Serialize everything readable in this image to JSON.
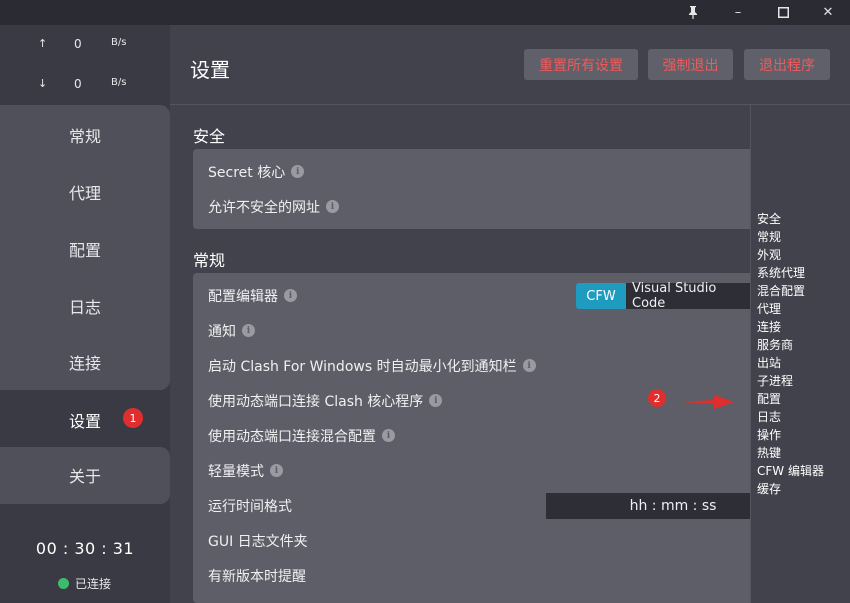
{
  "window": {
    "pin_icon": "pin-icon",
    "minimize": "–",
    "maximize": "☐",
    "close": "✕"
  },
  "traffic": {
    "up": {
      "arrow": "↑",
      "value": "0",
      "unit": "B/s"
    },
    "down": {
      "arrow": "↓",
      "value": "0",
      "unit": "B/s"
    }
  },
  "sidebar": {
    "items": [
      {
        "label": "常规"
      },
      {
        "label": "代理"
      },
      {
        "label": "配置"
      },
      {
        "label": "日志"
      },
      {
        "label": "连接"
      },
      {
        "label": "设置",
        "badge": "1"
      },
      {
        "label": "关于"
      }
    ],
    "time": "00 : 30 : 31",
    "status": "已连接"
  },
  "header": {
    "title": "设置",
    "reset_all": "重置所有设置",
    "force_quit": "强制退出",
    "quit": "退出程序"
  },
  "sections": {
    "security": {
      "title": "安全",
      "rows": [
        "Secret 核心",
        "允许不安全的网址"
      ]
    },
    "general": {
      "title": "常规",
      "rows": [
        "配置编辑器",
        "通知",
        "启动 Clash For Windows 时自动最小化到通知栏",
        "使用动态端口连接 Clash 核心程序",
        "使用动态端口连接混合配置",
        "轻量模式",
        "运行时间格式",
        "GUI 日志文件夹",
        "有新版本时提醒"
      ],
      "editor_option_on": "CFW",
      "editor_option_off": "Visual Studio Code",
      "time_format": "hh : mm : ss"
    }
  },
  "anchors": [
    "安全",
    "常规",
    "外观",
    "系统代理",
    "混合配置",
    "代理",
    "连接",
    "服务商",
    "出站",
    "子进程",
    "配置",
    "日志",
    "操作",
    "热键",
    "CFW 编辑器",
    "缓存"
  ],
  "annotation": {
    "marker": "2"
  },
  "colors": {
    "accent": "#1e9bbf",
    "danger": "#f05a5a",
    "connected": "#3dbd6b",
    "badge": "#e02d2d"
  }
}
